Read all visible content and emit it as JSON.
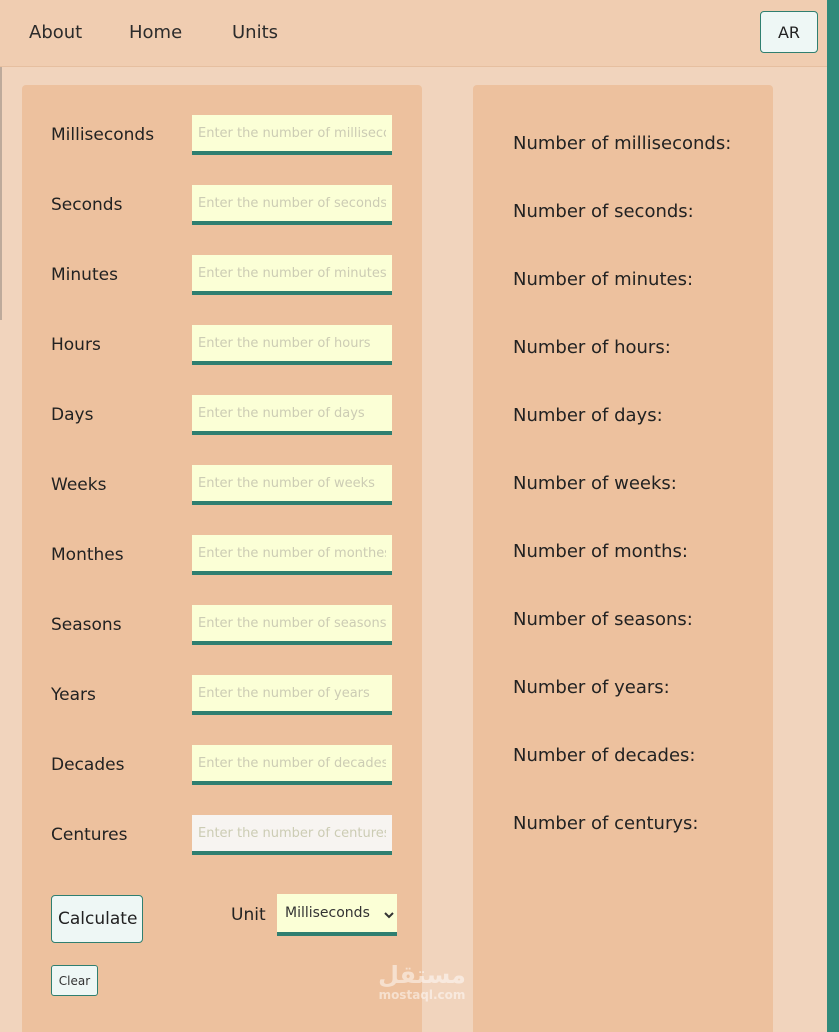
{
  "nav": {
    "links": [
      "About",
      "Home",
      "Units"
    ],
    "lang_button": "AR"
  },
  "form": {
    "fields": [
      {
        "label": "Milliseconds",
        "placeholder": "Enter the number of milliseconds"
      },
      {
        "label": "Seconds",
        "placeholder": "Enter the number of seconds"
      },
      {
        "label": "Minutes",
        "placeholder": "Enter the number of minutes"
      },
      {
        "label": "Hours",
        "placeholder": "Enter the number of hours"
      },
      {
        "label": "Days",
        "placeholder": "Enter the number of days"
      },
      {
        "label": "Weeks",
        "placeholder": "Enter the number of weeks"
      },
      {
        "label": "Monthes",
        "placeholder": "Enter the number of monthes"
      },
      {
        "label": "Seasons",
        "placeholder": "Enter the number of seasons"
      },
      {
        "label": "Years",
        "placeholder": "Enter the number of years"
      },
      {
        "label": "Decades",
        "placeholder": "Enter the number of decades"
      },
      {
        "label": "Centures",
        "placeholder": "Enter the number of centures"
      }
    ],
    "calculate_label": "Calculate",
    "unit_label": "Unit",
    "unit_selected": "Milliseconds",
    "clear_label": "Clear"
  },
  "results": [
    "Number of milliseconds:",
    "Number of seconds:",
    "Number of minutes:",
    "Number of hours:",
    "Number of days:",
    "Number of weeks:",
    "Number of months:",
    "Number of seasons:",
    "Number of years:",
    "Number of decades:",
    "Number of centurys:"
  ],
  "watermark": {
    "top": "مستقل",
    "bottom": "mostaql.com"
  },
  "colors": {
    "page_bg": "#f1d4bd",
    "panel_bg": "#edc19e",
    "accent_teal": "#2f7f70",
    "input_bg": "#fbffd6"
  }
}
